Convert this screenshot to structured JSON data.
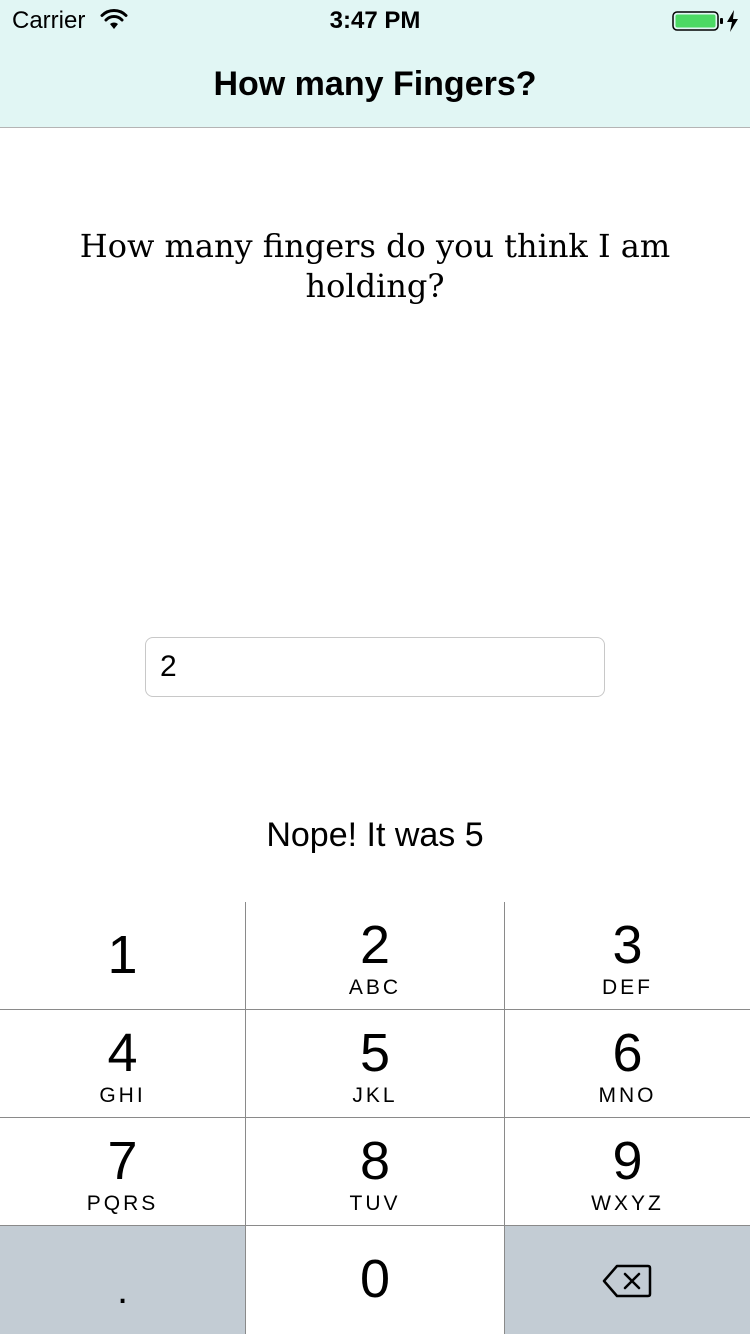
{
  "status_bar": {
    "carrier": "Carrier",
    "time": "3:47 PM",
    "wifi_icon": "wifi-icon",
    "battery_icon": "battery-charging-icon",
    "battery_color": "#4cd964"
  },
  "nav": {
    "title": "How many Fingers?",
    "background": "#e1f6f4"
  },
  "main": {
    "question": "How many fingers do you think I am holding?",
    "answer_value": "2",
    "result_text": "Nope! It was 5"
  },
  "keypad": {
    "keys": [
      {
        "digit": "1",
        "letters": ""
      },
      {
        "digit": "2",
        "letters": "ABC"
      },
      {
        "digit": "3",
        "letters": "DEF"
      },
      {
        "digit": "4",
        "letters": "GHI"
      },
      {
        "digit": "5",
        "letters": "JKL"
      },
      {
        "digit": "6",
        "letters": "MNO"
      },
      {
        "digit": "7",
        "letters": "PQRS"
      },
      {
        "digit": "8",
        "letters": "TUV"
      },
      {
        "digit": "9",
        "letters": "WXYZ"
      }
    ],
    "decimal": ".",
    "zero": "0",
    "delete_icon": "backspace-icon",
    "function_key_color": "#c3ccd4"
  }
}
